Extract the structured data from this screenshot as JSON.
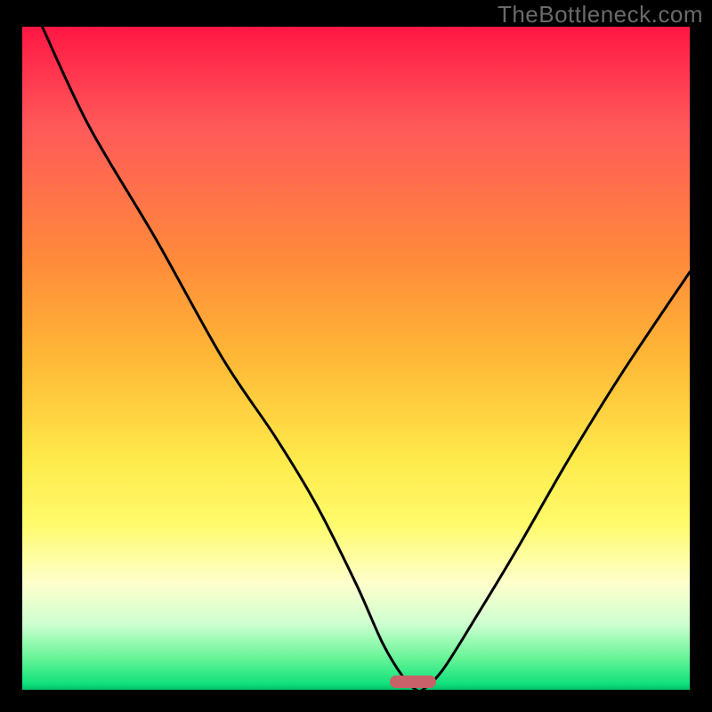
{
  "watermark": "TheBottleneck.com",
  "colors": {
    "background": "#000000",
    "gradient_top": "#ff1744",
    "gradient_mid": "#ffe94a",
    "gradient_bottom": "#00c26a",
    "curve_stroke": "#000000",
    "marker": "#c96168"
  },
  "chart_data": {
    "type": "line",
    "title": "",
    "xlabel": "",
    "ylabel": "",
    "xlim": [
      0,
      100
    ],
    "ylim": [
      0,
      100
    ],
    "grid": false,
    "legend": false,
    "series": [
      {
        "name": "bottleneck-curve",
        "x": [
          3,
          10,
          20,
          30,
          38,
          44,
          50,
          54,
          57,
          59,
          60,
          63,
          68,
          74,
          82,
          90,
          100
        ],
        "y": [
          100,
          85,
          68,
          50,
          38,
          28,
          16,
          7,
          2,
          0,
          0,
          3,
          11,
          21,
          35,
          48,
          63
        ]
      }
    ],
    "marker": {
      "x_start": 55,
      "x_end": 62,
      "y": 0
    },
    "annotations": []
  }
}
